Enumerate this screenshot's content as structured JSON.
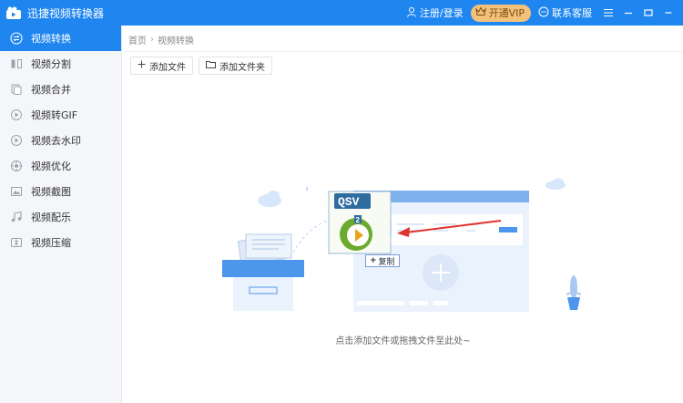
{
  "app": {
    "title": "迅捷视频转换器"
  },
  "titlebar": {
    "login_label": "注册/登录",
    "vip_label": "开通VIP",
    "service_label": "联系客服",
    "icons": [
      "user-icon",
      "crown-icon",
      "chat-bubble-icon",
      "menu-icon",
      "minimize-icon",
      "restore-icon",
      "close-icon"
    ]
  },
  "sidebar": {
    "items": [
      {
        "label": "视频转换",
        "icon": "convert-icon",
        "active": true
      },
      {
        "label": "视频分割",
        "icon": "split-icon"
      },
      {
        "label": "视频合并",
        "icon": "merge-icon"
      },
      {
        "label": "视频转GIF",
        "icon": "gif-icon"
      },
      {
        "label": "视频去水印",
        "icon": "watermark-icon"
      },
      {
        "label": "视频优化",
        "icon": "optimize-icon"
      },
      {
        "label": "视频截图",
        "icon": "screenshot-icon"
      },
      {
        "label": "视频配乐",
        "icon": "music-icon"
      },
      {
        "label": "视频压缩",
        "icon": "compress-icon"
      }
    ]
  },
  "breadcrumb": {
    "home": "首页",
    "sep": "›",
    "current": "视频转换"
  },
  "toolbar": {
    "add_file_label": "添加文件",
    "add_folder_label": "添加文件夹"
  },
  "dropzone": {
    "file_badge": "QSV",
    "file_badge_number": "2",
    "copy_label": "复制",
    "hint": "点击添加文件或拖拽文件至此处~"
  },
  "colors": {
    "accent": "#1f86f0",
    "vip": "#f3c27a",
    "sidebar_bg": "#f4f6f9",
    "arrow": "#e0322c",
    "file_green": "#5fa02a"
  }
}
